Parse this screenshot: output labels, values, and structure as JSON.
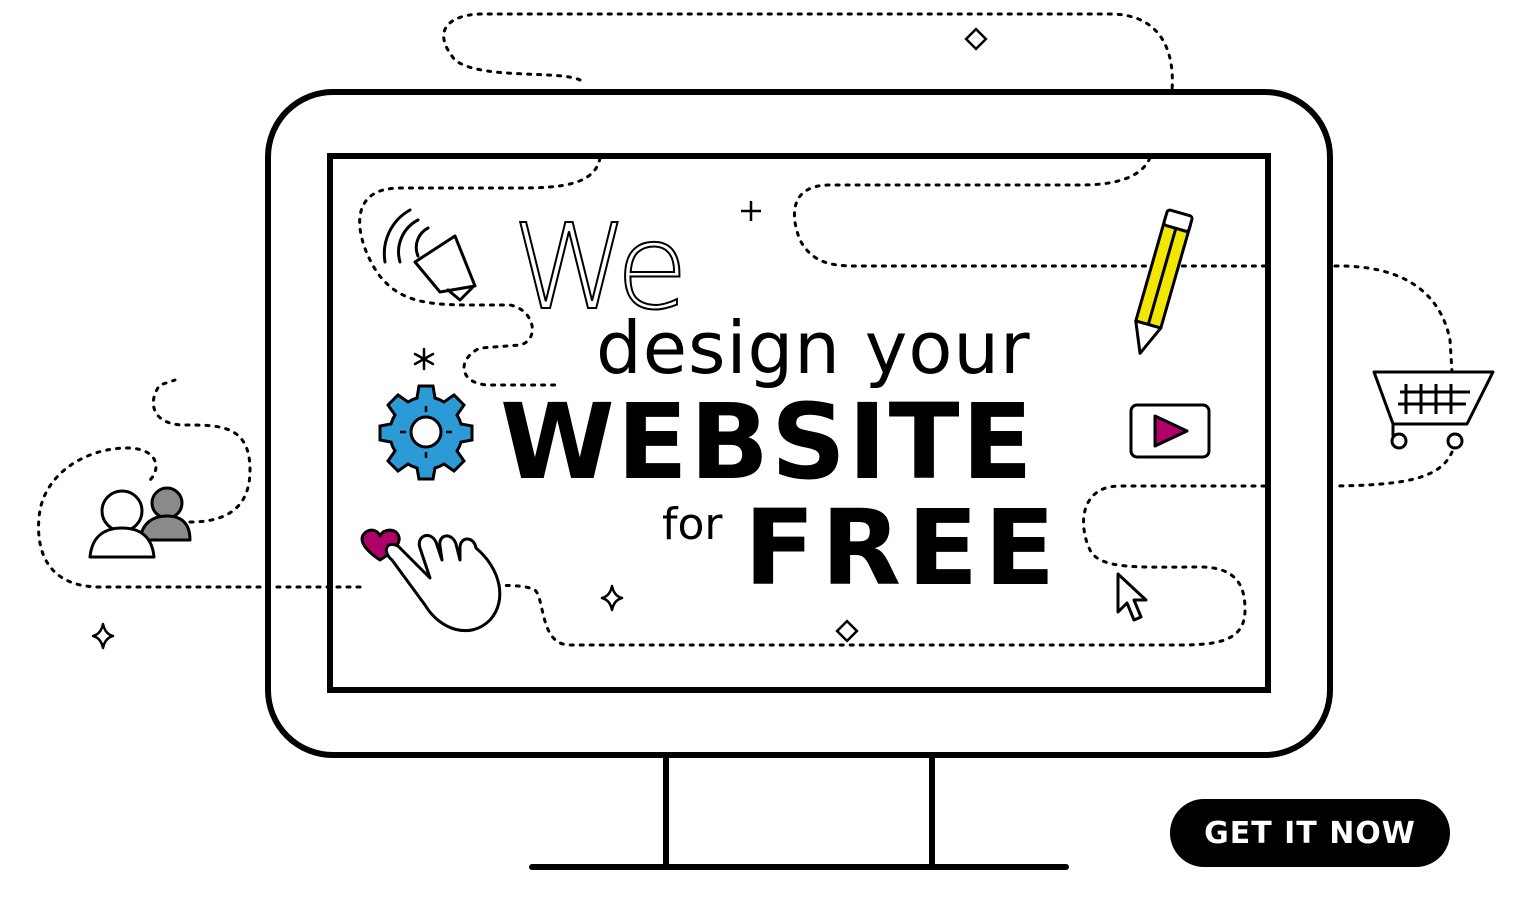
{
  "headline": {
    "we": "We",
    "design_your": "design your",
    "website": "WEBSITE",
    "for": "for",
    "free": "FREE"
  },
  "cta": {
    "label": "GET IT NOW"
  },
  "icons": [
    "megaphone-icon",
    "pencil-icon",
    "gear-icon",
    "play-icon",
    "shopping-cart-icon",
    "users-icon",
    "heart-hand-icon",
    "cursor-icon",
    "sparkle-icon",
    "diamond-icon",
    "plus-icon",
    "asterisk-icon"
  ],
  "colors": {
    "ink": "#000000",
    "gear": "#2b9ad6",
    "pencil": "#f3e600",
    "accent": "#b0006a",
    "user-secondary": "#8a8a8a",
    "background": "#ffffff"
  }
}
